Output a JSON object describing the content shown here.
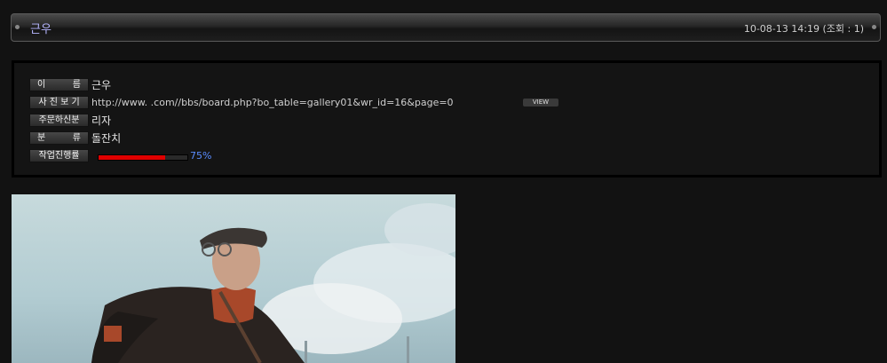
{
  "post": {
    "title": "근우",
    "meta": "10-08-13 14:19 (조회 : 1)"
  },
  "info": {
    "name_label": [
      "이",
      "름"
    ],
    "name_value": "근우",
    "photo_label": "사 진 보 기",
    "photo_url": "http://www.                    .com//bbs/board.php?bo_table=gallery01&wr_id=16&page=0",
    "view_label": "VIEW",
    "orderer_label": "주문하신분",
    "orderer_value": "리자",
    "category_label": [
      "분",
      "류"
    ],
    "category_value": "돌잔치",
    "progress_label": "작업진행률",
    "progress_percent": 75,
    "progress_text": "75%"
  },
  "colors": {
    "progress": "#e00000",
    "progress_text": "#5a8cff",
    "title": "#b6b6ff"
  }
}
